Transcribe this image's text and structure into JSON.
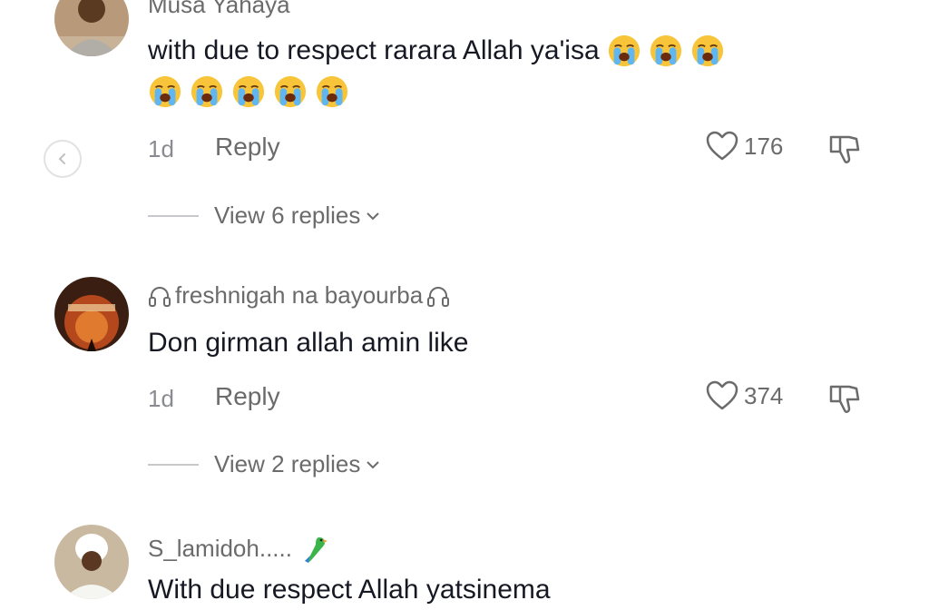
{
  "comments": [
    {
      "username": "Musa Yahaya",
      "text": "with due to respect rarara Allah ya'isa",
      "time": "1d",
      "reply_label": "Reply",
      "likes": "176",
      "view_replies": "View 6 replies"
    },
    {
      "username": "freshnigah na bayourba",
      "text": "Don girman allah amin like",
      "time": "1d",
      "reply_label": "Reply",
      "likes": "374",
      "view_replies": "View 2 replies"
    },
    {
      "username": "S_lamidoh.....",
      "text": "With due respect Allah yatsinema"
    }
  ],
  "emojis": {
    "first_line_count": 3,
    "second_line_count": 5,
    "name": "loudly-crying-face"
  },
  "icons": {
    "like": "heart-outline-icon",
    "dislike": "thumbs-down-icon",
    "back": "chevron-left-icon",
    "username_decor": "headphone-icon",
    "username_emoji": "parrot-icon"
  },
  "colors": {
    "text": "#161823",
    "secondary": "#6b6b6b",
    "muted": "#8a8b91"
  }
}
